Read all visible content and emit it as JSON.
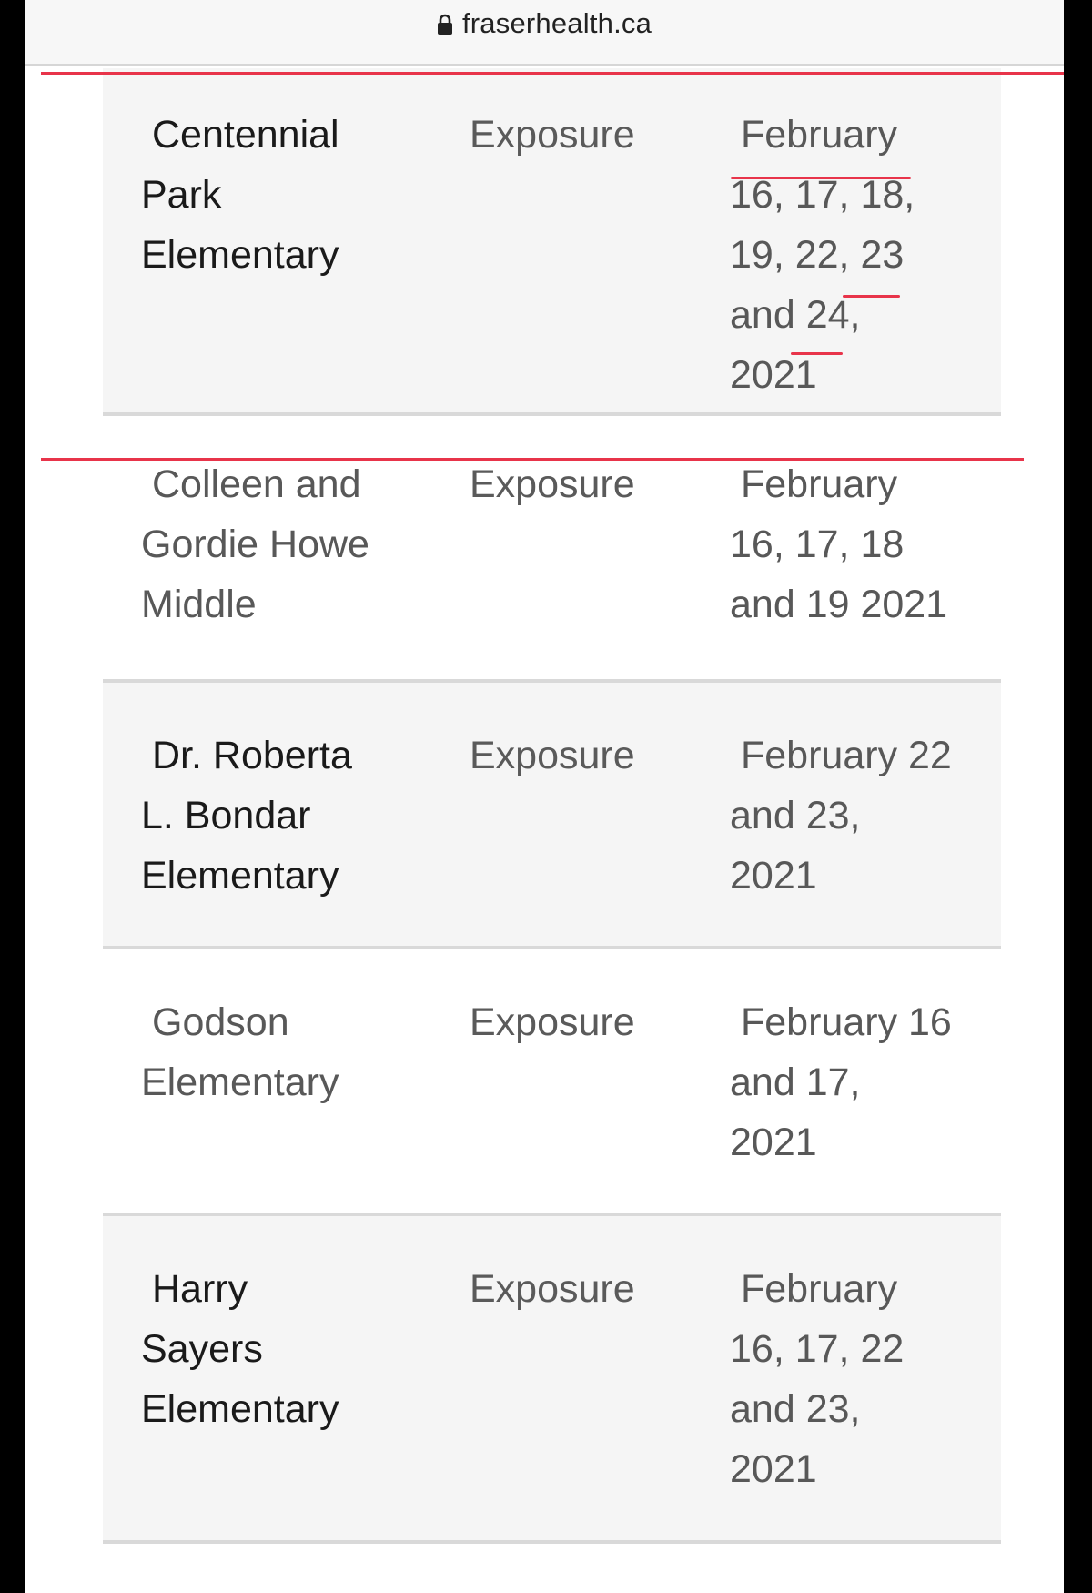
{
  "browser": {
    "url": "fraserhealth.ca"
  },
  "rows": [
    {
      "school": [
        "Centennial",
        "Park",
        "Elementary"
      ],
      "type": "Exposure",
      "dates": [
        "February",
        "16, 17, 18,",
        "19, 22, 23",
        "and 24,",
        "2021"
      ]
    },
    {
      "school": [
        "Colleen and",
        "Gordie Howe",
        "Middle"
      ],
      "type": "Exposure",
      "dates": [
        "February",
        "16, 17, 18",
        "and 19 2021"
      ]
    },
    {
      "school": [
        "Dr. Roberta",
        "L. Bondar",
        "Elementary"
      ],
      "type": "Exposure",
      "dates": [
        "February 22",
        "and 23,",
        "2021"
      ]
    },
    {
      "school": [
        "Godson",
        "Elementary"
      ],
      "type": "Exposure",
      "dates": [
        "February 16",
        "and 17,",
        "2021"
      ]
    },
    {
      "school": [
        "Harry",
        "Sayers",
        "Elementary"
      ],
      "type": "Exposure",
      "dates": [
        "February",
        "16, 17, 22",
        "and 23,",
        "2021"
      ]
    }
  ],
  "colors": {
    "annotation": "#e8344a",
    "row_alt": "#f5f5f5",
    "divider": "#d9d9d9"
  },
  "icons": {
    "lock": "lock-icon"
  }
}
